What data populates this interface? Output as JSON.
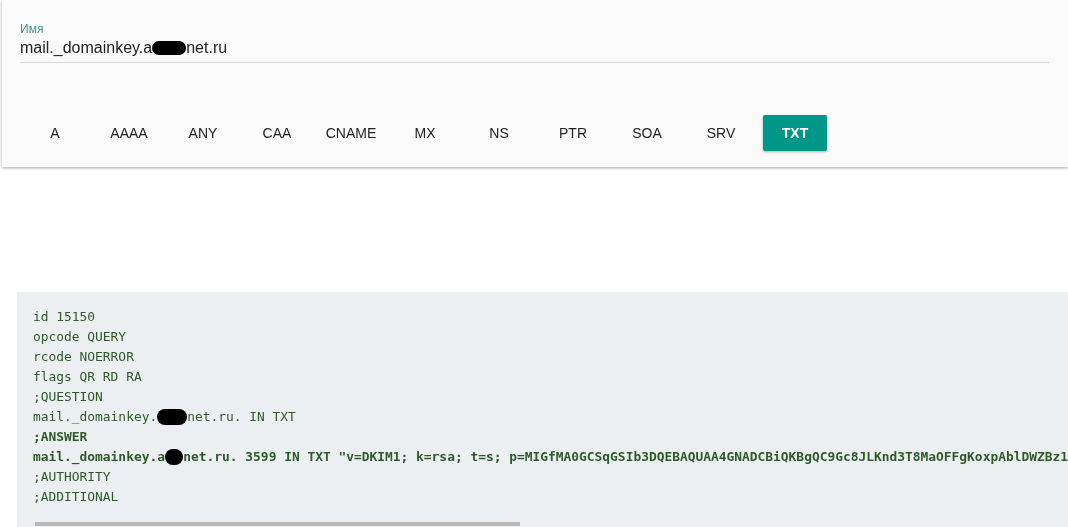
{
  "name_field": {
    "label": "Имя",
    "value_parts": [
      "mail._domainkey.a",
      "net.ru"
    ]
  },
  "record_types": [
    {
      "label": "A",
      "selected": false
    },
    {
      "label": "AAAA",
      "selected": false
    },
    {
      "label": "ANY",
      "selected": false
    },
    {
      "label": "CAA",
      "selected": false
    },
    {
      "label": "CNAME",
      "selected": false
    },
    {
      "label": "MX",
      "selected": false
    },
    {
      "label": "NS",
      "selected": false
    },
    {
      "label": "PTR",
      "selected": false
    },
    {
      "label": "SOA",
      "selected": false
    },
    {
      "label": "SRV",
      "selected": false
    },
    {
      "label": "TXT",
      "selected": true
    }
  ],
  "output_lines": [
    {
      "parts": [
        "id 15150"
      ],
      "bold": false
    },
    {
      "parts": [
        "opcode QUERY"
      ],
      "bold": false
    },
    {
      "parts": [
        "rcode NOERROR"
      ],
      "bold": false
    },
    {
      "parts": [
        "flags QR RD RA"
      ],
      "bold": false
    },
    {
      "parts": [
        ";QUESTION"
      ],
      "bold": false
    },
    {
      "parts": [
        "mail._domainkey.",
        "net.ru. IN TXT"
      ],
      "bold": false
    },
    {
      "parts": [
        ";ANSWER"
      ],
      "bold": true
    },
    {
      "parts": [
        "mail._domainkey.a",
        "net.ru. 3599 IN TXT \"v=DKIM1; k=rsa; t=s; p=MIGfMA0GCSqGSIb3DQEBAQUAA4GNADCBiQKBgQC9Gc8JLKnd3T8MaOFFgKoxpAblDWZBz1"
      ],
      "bold": true
    },
    {
      "parts": [
        ";AUTHORITY"
      ],
      "bold": false
    },
    {
      "parts": [
        ";ADDITIONAL"
      ],
      "bold": false
    }
  ]
}
